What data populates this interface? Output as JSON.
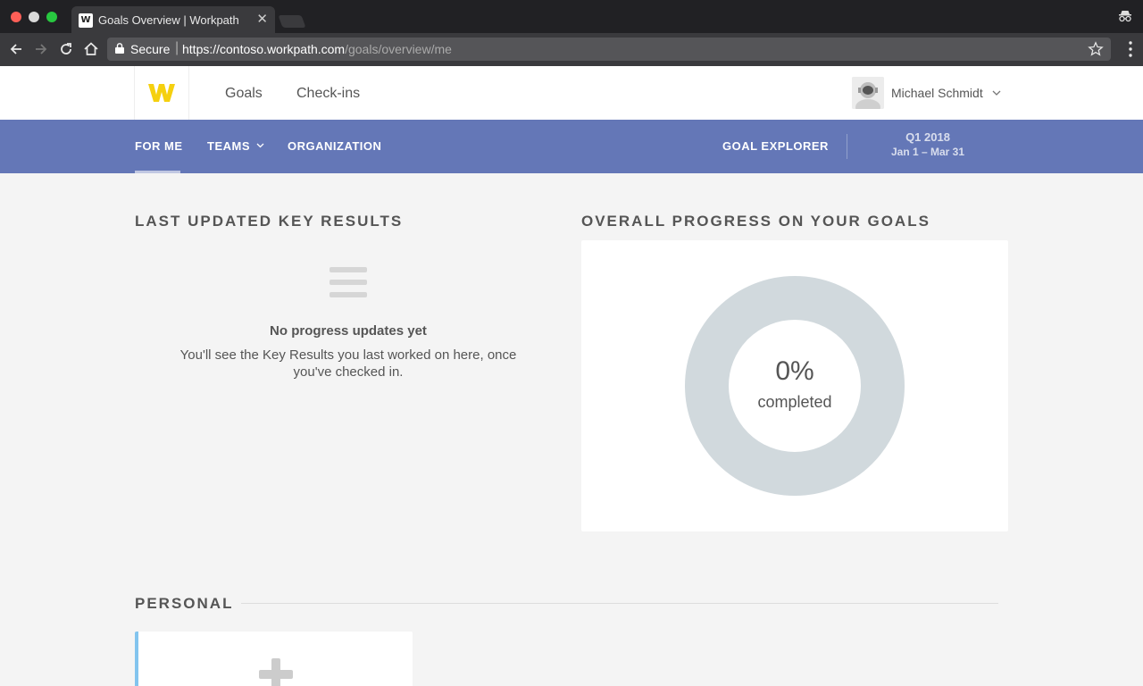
{
  "browser": {
    "tab_title": "Goals Overview | Workpath",
    "tab_favicon": "W",
    "secure_label": "Secure",
    "url_host": "https://contoso.workpath.com",
    "url_path": "/goals/overview/me"
  },
  "app": {
    "logo": "W",
    "nav": [
      "Goals",
      "Check-ins"
    ],
    "user_name": "Michael Schmidt"
  },
  "subnav": {
    "for_me": "FOR ME",
    "teams": "TEAMS",
    "organization": "ORGANIZATION",
    "goal_explorer": "GOAL EXPLORER",
    "period_quarter": "Q1 2018",
    "period_dates": "Jan 1 – Mar 31"
  },
  "last_updated": {
    "title": "LAST UPDATED KEY RESULTS",
    "empty_title": "No progress updates yet",
    "empty_text": "You'll see the Key Results you last worked on here, once you've checked in."
  },
  "progress": {
    "title": "OVERALL PROGRESS ON YOUR GOALS",
    "value": "0%",
    "label": "completed",
    "fraction": 0
  },
  "personal": {
    "title": "PERSONAL"
  },
  "colors": {
    "subnav_bg": "#6477b7",
    "donut_track": "#d1d9dd",
    "logo_yellow": "#f5d00f",
    "add_card_accent": "#82c4ee"
  }
}
